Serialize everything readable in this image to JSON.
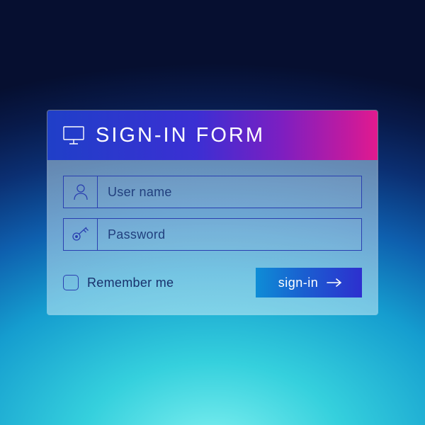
{
  "header": {
    "title": "SIGN-IN FORM",
    "icon": "monitor-icon"
  },
  "fields": {
    "username": {
      "placeholder": "User name",
      "value": "",
      "icon": "user-icon"
    },
    "password": {
      "placeholder": "Password",
      "value": "",
      "icon": "key-icon"
    }
  },
  "remember": {
    "label": "Remember me",
    "checked": false
  },
  "submit": {
    "label": "sign-in",
    "icon": "arrow-right-icon"
  },
  "colors": {
    "border": "#2a3fb0",
    "text": "#18316c",
    "header_gradient": [
      "#1f3fc8",
      "#e21a8e"
    ],
    "button_gradient": [
      "#0e8dd6",
      "#2d2fcf"
    ]
  }
}
